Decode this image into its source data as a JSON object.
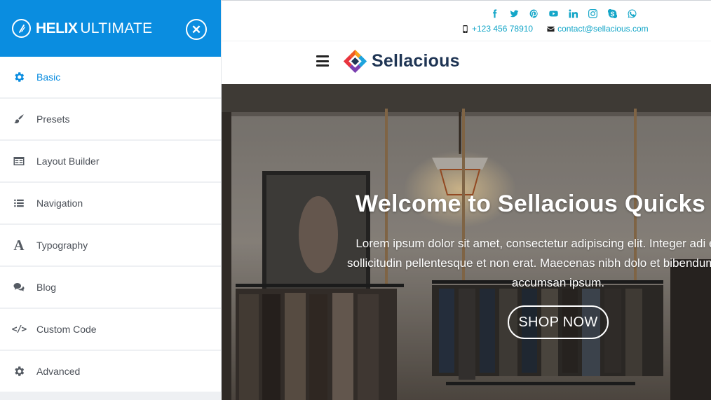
{
  "panel": {
    "brand_strong": "HELIX",
    "brand_light": "ULTIMATE",
    "accent": "#0a8de0",
    "nav": [
      {
        "label": "Basic",
        "icon": "gear-icon",
        "active": true
      },
      {
        "label": "Presets",
        "icon": "brush-icon"
      },
      {
        "label": "Layout Builder",
        "icon": "layout-icon"
      },
      {
        "label": "Navigation",
        "icon": "list-icon"
      },
      {
        "label": "Typography",
        "icon": "font-icon"
      },
      {
        "label": "Blog",
        "icon": "comments-icon"
      },
      {
        "label": "Custom Code",
        "icon": "code-icon"
      },
      {
        "label": "Advanced",
        "icon": "gear-icon"
      }
    ]
  },
  "site": {
    "social": [
      "facebook-icon",
      "twitter-icon",
      "pinterest-icon",
      "youtube-icon",
      "linkedin-icon",
      "instagram-icon",
      "skype-icon",
      "whatsapp-icon"
    ],
    "social_color": "#14a6c8",
    "phone": "+123 456 78910",
    "email": "contact@sellacious.com",
    "logo_text": "Sellacious",
    "hero": {
      "title": "Welcome to Sellacious Quicks",
      "text": "Lorem ipsum dolor sit amet, consectetur adipiscing elit. Integer adi eget risus sollicitudin pellentesque et non erat. Maecenas nibh dolo et bibendum a, sagittis accumsan ipsum.",
      "button": "SHOP NOW"
    }
  }
}
